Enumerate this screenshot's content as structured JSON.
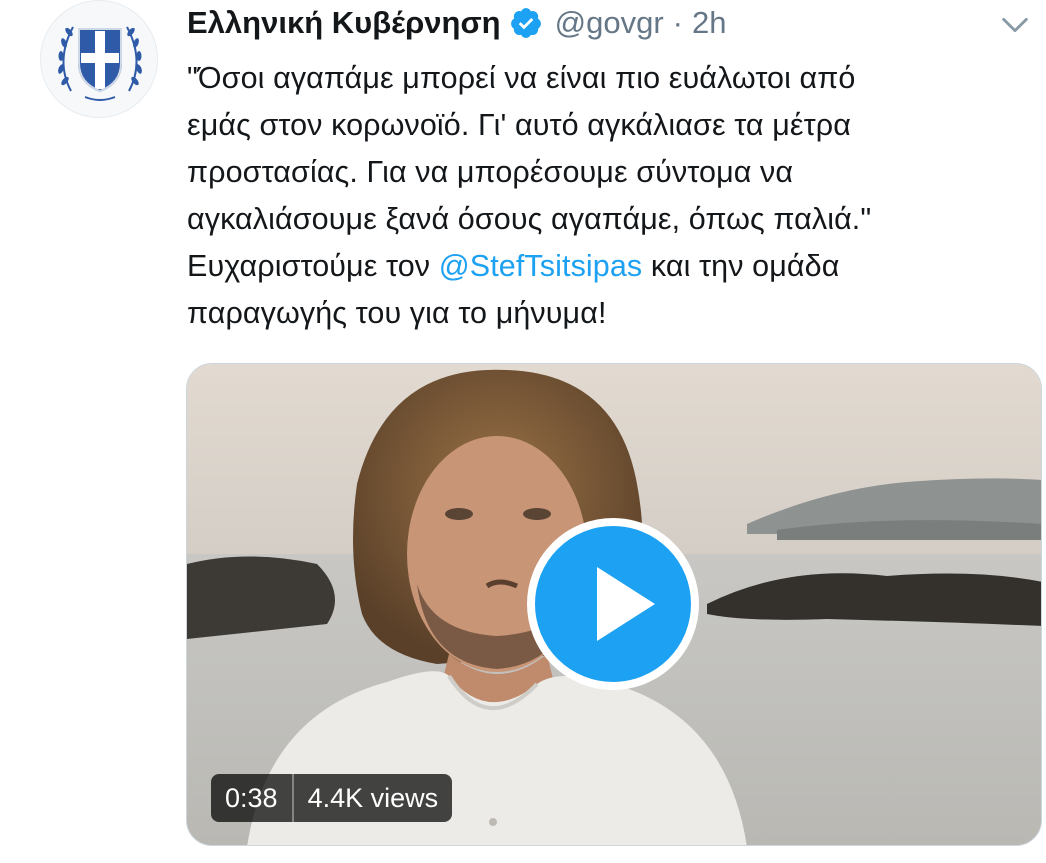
{
  "tweet": {
    "author": {
      "display_name": "Ελληνική Κυβέρνηση",
      "handle": "@govgr",
      "verified": true
    },
    "separator": "·",
    "time": "2h",
    "text_lines": [
      "\"Όσοι αγαπάμε μπορεί να είναι πιο ευάλωτοι από",
      "εμάς στον κορωνοϊό. Γι' αυτό αγκάλιασε τα μέτρα",
      "προστασίας. Για να μπορέσουμε σύντομα να",
      "αγκαλιάσουμε ξανά όσους αγαπάμε, όπως παλιά.\""
    ],
    "line5_before": "Ευχαριστούμε τον ",
    "mention": "@StefTsitsipas",
    "line5_after": " και την ομάδα",
    "line6": "παραγωγής του για το μήνυμα!",
    "media": {
      "duration": "0:38",
      "views": "4.4K views"
    }
  },
  "colors": {
    "accent": "#1da1f2",
    "text": "#14171a",
    "secondary": "#657786"
  },
  "icons": {
    "avatar": "greek-coat-of-arms-icon",
    "verified": "verified-badge-icon",
    "menu": "chevron-down-icon",
    "play": "play-icon"
  }
}
